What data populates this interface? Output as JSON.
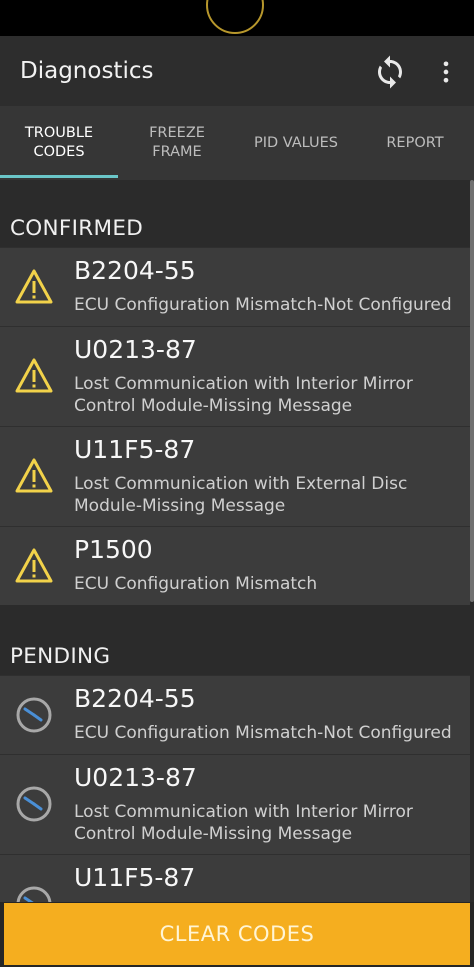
{
  "app": {
    "title": "Diagnostics"
  },
  "toolbar": {
    "refresh_icon": "refresh-icon",
    "menu_icon": "more-vert-icon"
  },
  "tabs": [
    {
      "label": "TROUBLE\nCODES",
      "active": true
    },
    {
      "label": "FREEZE\nFRAME",
      "active": false
    },
    {
      "label": "PID VALUES",
      "active": false
    },
    {
      "label": "REPORT",
      "active": false
    }
  ],
  "sections": {
    "confirmed": {
      "title": "CONFIRMED",
      "icon": "warning-icon",
      "items": [
        {
          "code": "B2204-55",
          "description": "ECU Configuration Mismatch-Not Configured"
        },
        {
          "code": "U0213-87",
          "description": "Lost Communication with Interior Mirror Control Module-Missing Message"
        },
        {
          "code": "U11F5-87",
          "description": "Lost Communication with External Disc Module-Missing Message"
        },
        {
          "code": "P1500",
          "description": "ECU Configuration Mismatch"
        }
      ]
    },
    "pending": {
      "title": "PENDING",
      "icon": "clock-icon",
      "items": [
        {
          "code": "B2204-55",
          "description": "ECU Configuration Mismatch-Not Configured"
        },
        {
          "code": "U0213-87",
          "description": "Lost Communication with Interior Mirror Control Module-Missing Message"
        },
        {
          "code": "U11F5-87",
          "description": ""
        }
      ]
    }
  },
  "footer": {
    "clear_label": "CLEAR CODES"
  },
  "colors": {
    "accent": "#6bc7c9",
    "warning": "#f2d24a",
    "button": "#f5ae1f"
  }
}
